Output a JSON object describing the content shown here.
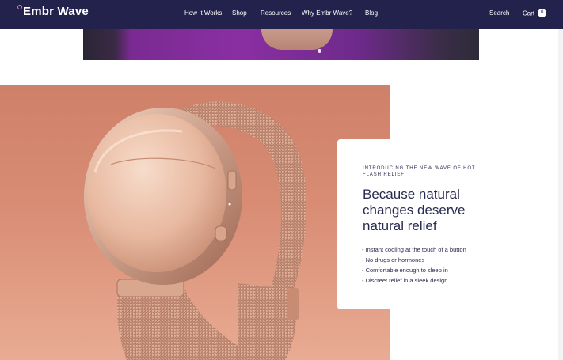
{
  "header": {
    "brand": "Embr Wave",
    "nav": [
      {
        "label": "How It Works"
      },
      {
        "label": "Shop"
      },
      {
        "label": "Resources"
      },
      {
        "label": "Why Embr Wave?"
      },
      {
        "label": "Blog"
      }
    ],
    "search_label": "Search",
    "cart_label": "Cart",
    "cart_count": "0"
  },
  "promo": {
    "eyebrow": "Introducing the new wave of hot flash relief",
    "headline": "Because natural changes deserve natural relief",
    "bullets": [
      "- Instant cooling at the touch of a button",
      "- No drugs or hormones",
      "- Comfortable enough to sleep in",
      "- Discreet relief in a sleek design"
    ]
  },
  "colors": {
    "header_bg": "#22224d",
    "text_dark": "#2a2a50",
    "product_bg_top": "#cf8068",
    "product_bg_bottom": "#e9ab93",
    "rose_gold": "#e0b59c"
  },
  "icons": [
    "embr-logo-dot-icon",
    "cart-count-badge"
  ]
}
